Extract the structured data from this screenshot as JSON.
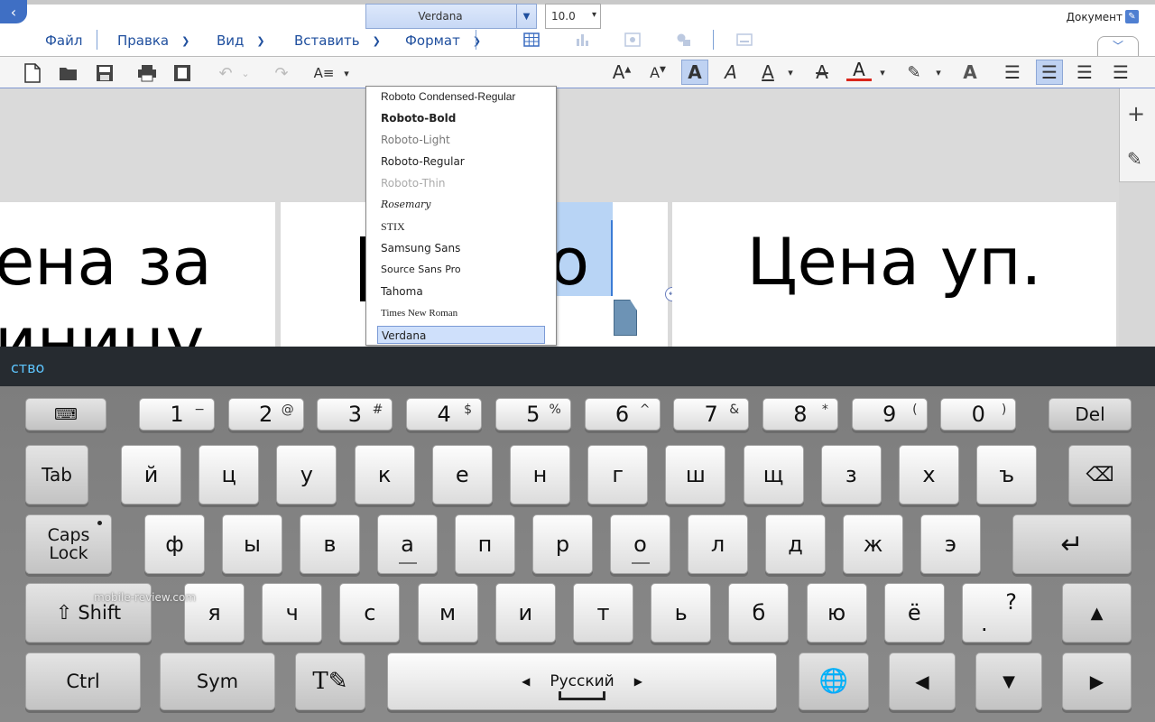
{
  "app": {
    "doc_label": "Документ"
  },
  "menu": {
    "file": "Файл",
    "edit": "Правка",
    "view": "Вид",
    "insert": "Вставить",
    "format": "Формат"
  },
  "toolbar": {
    "font_value": "Verdana",
    "size_value": "10.0"
  },
  "cells": {
    "left_line1": "ена за",
    "left_line2": "иницу",
    "mid_text": "о",
    "right_text": "Цена уп."
  },
  "font_list": [
    "Roboto Condensed-Regular",
    "Roboto-Bold",
    "Roboto-Light",
    "Roboto-Regular",
    "Roboto-Thin",
    "Rosemary",
    "STIX",
    "Samsung Sans",
    "Source Sans Pro",
    "Tahoma",
    "Times New Roman",
    "Verdana"
  ],
  "suggestion": "ство",
  "watermark": "mobile-review.com",
  "keyboard": {
    "numrow": [
      {
        "k": "1",
        "s": "−"
      },
      {
        "k": "2",
        "s": "@"
      },
      {
        "k": "3",
        "s": "#"
      },
      {
        "k": "4",
        "s": "$"
      },
      {
        "k": "5",
        "s": "%"
      },
      {
        "k": "6",
        "s": "^"
      },
      {
        "k": "7",
        "s": "&"
      },
      {
        "k": "8",
        "s": "*"
      },
      {
        "k": "9",
        "s": "("
      },
      {
        "k": "0",
        "s": ")"
      }
    ],
    "row1": [
      "й",
      "ц",
      "у",
      "к",
      "е",
      "н",
      "г",
      "ш",
      "щ",
      "з",
      "х",
      "ъ"
    ],
    "row2": [
      "ф",
      "ы",
      "в",
      "а",
      "п",
      "р",
      "о",
      "л",
      "д",
      "ж",
      "э"
    ],
    "row3": [
      "я",
      "ч",
      "с",
      "м",
      "и",
      "т",
      "ь",
      "б",
      "ю",
      "ё"
    ],
    "del": "Del",
    "tab": "Tab",
    "caps1": "Caps",
    "caps2": "Lock",
    "shift": "Shift",
    "ctrl": "Ctrl",
    "sym": "Sym",
    "lang": "Русский",
    "period": ".",
    "question": "?"
  }
}
